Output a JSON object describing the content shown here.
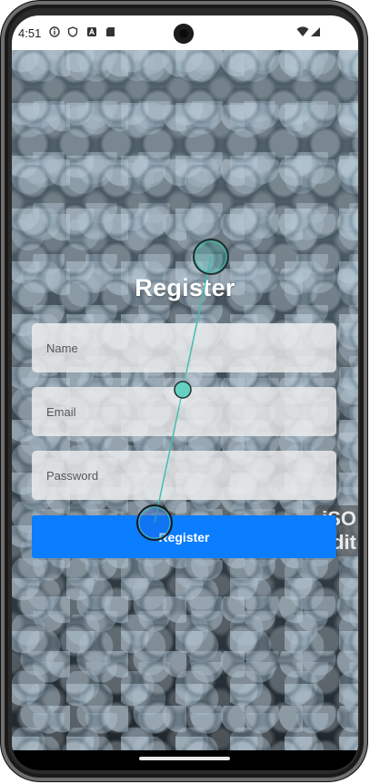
{
  "status_bar": {
    "time": "4:51",
    "icons": [
      "info-icon",
      "shield-icon",
      "a-icon",
      "sd-card-icon",
      "wifi-icon",
      "cell-signal-icon"
    ]
  },
  "register": {
    "title": "Register",
    "name_placeholder": "Name",
    "email_placeholder": "Email",
    "password_placeholder": "Password",
    "button_label": "Register"
  },
  "watermark": {
    "line1": "iSO",
    "line2": "dit"
  },
  "colors": {
    "button": "#0b7dff",
    "gesture_trail": "#3fbfb0"
  }
}
